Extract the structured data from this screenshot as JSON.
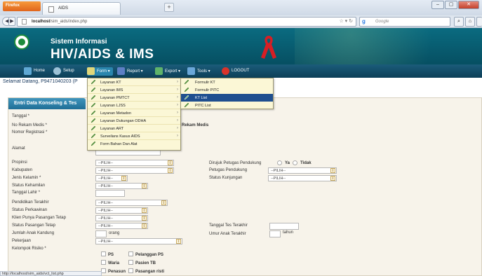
{
  "browser": {
    "app_button": "Firefox",
    "tab_title": "AIDS",
    "url_host": "localhost",
    "url_path": "/sim_aids/index.php",
    "search_placeholder": "Google",
    "status_url": "http://localhost/sim_aids/vct_list.php"
  },
  "header": {
    "subtitle": "Sistem Informasi",
    "title": "HIV/AIDS & IMS"
  },
  "menu": [
    {
      "label": "Home",
      "color": "#5fa8d3"
    },
    {
      "label": "Setup",
      "color": "#9bc1d6"
    },
    {
      "label": "Form",
      "color": "#e0d77a"
    },
    {
      "label": "Report",
      "color": "#5d7fc4"
    },
    {
      "label": "Export",
      "color": "#5fb36a"
    },
    {
      "label": "Tools",
      "color": "#6aa7d8"
    },
    {
      "label": "LOGOUT",
      "color": "#d9332a"
    }
  ],
  "welcome": "Selamat Datang, P9471040203 (P",
  "panel_title": "Entri Data Konseling & Tes",
  "form_dropdown": [
    {
      "label": "Layanan KT",
      "has_sub": true
    },
    {
      "label": "Layanan IMS",
      "has_sub": true
    },
    {
      "label": "Layanan PMTCT",
      "has_sub": true
    },
    {
      "label": "Layanan LJSS",
      "has_sub": true
    },
    {
      "label": "Layanan Metadon",
      "has_sub": true
    },
    {
      "label": "Layanan Dukungan ODHA",
      "has_sub": true
    },
    {
      "label": "Layanan ART",
      "has_sub": true
    },
    {
      "label": "Surveilans Kasus AIDS",
      "has_sub": true
    },
    {
      "label": "Form Bahan Dan Alat",
      "has_sub": false
    }
  ],
  "kt_submenu": [
    {
      "label": "Formulir KT",
      "highlighted": false
    },
    {
      "label": "Formulir PITC",
      "highlighted": false
    },
    {
      "label": "KT List",
      "highlighted": true
    },
    {
      "label": "PITC List",
      "highlighted": false
    }
  ],
  "form": {
    "tanggal": "Tanggal *",
    "no_rekam_medis": "No Rekam Medis *",
    "rekam_medis_fragment": "Rekam Medis",
    "nomor_registrasi": "Nomor Registrasi *",
    "alamat": "Alamat",
    "propinsi": "Propinsi",
    "kabupaten": "Kabupaten",
    "jenis_kelamin": "Jenis Kelamin *",
    "status_kehamilan": "Status Kehamilan",
    "tanggal_lahir": "Tanggal Lahir *",
    "pendidikan": "Pendidikan Terakhir",
    "status_perkawinan": "Status Perkawinan",
    "klien_pasangan": "Klien Punya Pasangan Tetap",
    "status_pasangan": "Status Pasangan Tetap",
    "jumlah_anak": "Jumlah Anak Kandung",
    "jumlah_anak_unit": "orang",
    "pekerjaan": "Pekerjaan",
    "kelompok_risiko": "Kelompok Risiko *",
    "dirujuk": "Dirujuk Petugas Pendukung",
    "ya": "Ya",
    "tidak": "Tidak",
    "petugas_pendukung": "Petugas Pendukung",
    "status_kunjungan": "Status Kunjungan",
    "tanggal_tes": "Tanggal Tes Terakhir",
    "umur_anak": "Umur Anak Terakhir",
    "umur_unit": "tahun",
    "pilih": "--PILIH--",
    "risks": [
      "PS",
      "Pelanggan PS",
      "Waria",
      "Pasien TB",
      "Penasun",
      "Pasangan risti"
    ]
  }
}
